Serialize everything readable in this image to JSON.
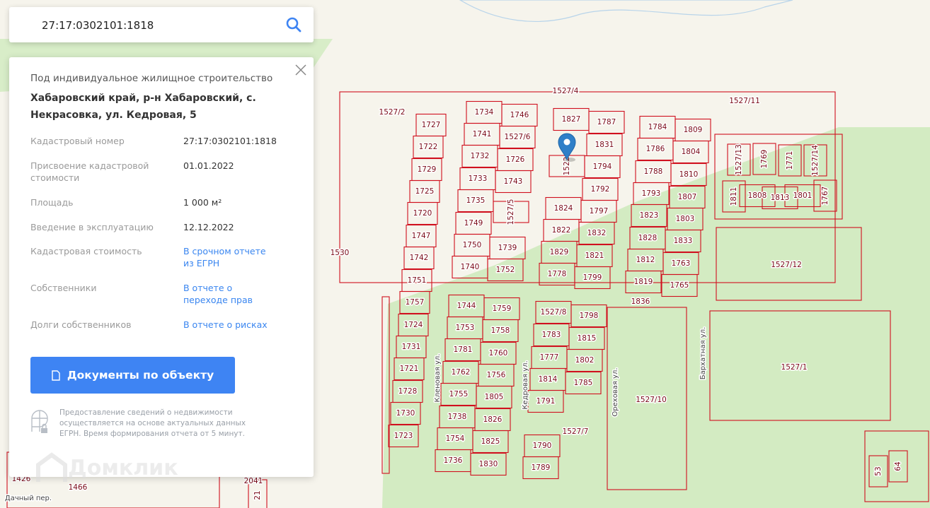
{
  "search": {
    "value": "27:17:0302101:1818",
    "icon": "search-icon"
  },
  "panel": {
    "purpose": "Под индивидуальное жилищное строительство",
    "address": "Хабаровский край, р-н Хабаровский, с. Некрасовка, ул. Кедровая, 5",
    "rows": [
      {
        "key": "Кадастровый номер",
        "value": "27:17:0302101:1818"
      },
      {
        "key": "Присвоение кадастровой стоимости",
        "value": "01.01.2022"
      },
      {
        "key": "Площадь",
        "value": "1 000 м²"
      },
      {
        "key": "Введение в эксплуатацию",
        "value": "12.12.2022"
      },
      {
        "key": "Кадастровая стоимость",
        "value": "В срочном отчете из ЕГРН"
      },
      {
        "key": "Собственники",
        "value": "В отчете о переходе прав"
      },
      {
        "key": "Долги собственников",
        "value": "В отчете о рисках"
      }
    ],
    "doc_button": "Документы по объекту",
    "note": "Предоставление сведений о недвижимости осуществляется на основе актуальных данных ЕГРН. Время формирования отчета от 5 минут."
  },
  "watermark": "Домклик",
  "map": {
    "parcels": [
      "1727",
      "1722",
      "1729",
      "1725",
      "1720",
      "1747",
      "1742",
      "1751",
      "1757",
      "1724",
      "1731",
      "1721",
      "1728",
      "1730",
      "1723",
      "1734",
      "1746",
      "1741",
      "1527/6",
      "1732",
      "1726",
      "1733",
      "1743",
      "1735",
      "1749",
      "1750",
      "1739",
      "1740",
      "1752",
      "1827",
      "1787",
      "1831",
      "1794",
      "1792",
      "1824",
      "1797",
      "1822",
      "1832",
      "1829",
      "1821",
      "1778",
      "1799",
      "1784",
      "1809",
      "1786",
      "1804",
      "1788",
      "1810",
      "1793",
      "1807",
      "1823",
      "1803",
      "1828",
      "1833",
      "1812",
      "1763",
      "1819",
      "1765",
      "1808",
      "1813",
      "1801",
      "1527/12",
      "1527/1",
      "1527/11",
      "1527/4",
      "1527/2",
      "1530",
      "1836",
      "1744",
      "1759",
      "1753",
      "1758",
      "1781",
      "1760",
      "1762",
      "1756",
      "1755",
      "1805",
      "1738",
      "1826",
      "1754",
      "1825",
      "1736",
      "1830",
      "1527/8",
      "1798",
      "1783",
      "1815",
      "1777",
      "1802",
      "1814",
      "1785",
      "1791",
      "1527/7",
      "1790",
      "1789",
      "1527/10",
      "1426",
      "1466",
      "2041"
    ],
    "vertical_parcels": [
      "1527/5",
      "1522",
      "1527/13",
      "1769",
      "1771",
      "1527/14",
      "1811",
      "1767",
      "53",
      "64",
      "21"
    ],
    "streets": [
      "Кленовая ул.",
      "Кедровая ул.",
      "Ореховая ул.",
      "Бархатная ул.",
      "Дачный пер."
    ]
  }
}
